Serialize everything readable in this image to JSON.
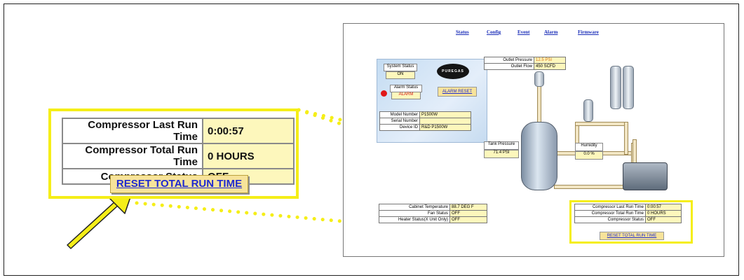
{
  "zoom_panel": {
    "rows": [
      {
        "label": "Compressor Last Run Time",
        "value": "0:00:57"
      },
      {
        "label": "Compressor Total Run Time",
        "value": "0 HOURS"
      },
      {
        "label": "Compressor Status",
        "value": "OFF"
      }
    ],
    "reset_button": "RESET TOTAL RUN TIME"
  },
  "screenshot": {
    "nav": [
      "Status",
      "Config",
      "Event",
      "Alarm",
      "Firmware"
    ],
    "system_status": {
      "label": "System Status",
      "value": "ON"
    },
    "alarm_status": {
      "label": "Alarm Status",
      "value": "ALARM"
    },
    "alarm_reset": "ALARM RESET",
    "logo_text": "PUREGAS",
    "device_info": [
      {
        "label": "Model Number",
        "value": "P1500W"
      },
      {
        "label": "Serial Number",
        "value": ""
      },
      {
        "label": "Device ID",
        "value": "R&D P1500W"
      }
    ],
    "outlet": [
      {
        "label": "Outlet Pressure",
        "value": "12.5 PSI"
      },
      {
        "label": "Outlet Flow",
        "value": "450 SCFD"
      }
    ],
    "tank_pressure": {
      "label": "Tank Pressure",
      "value": "71.4 PSI"
    },
    "humidity": {
      "label": "Humidity",
      "value": "0.0 %"
    },
    "cabinet": [
      {
        "label": "Cabinet Temperature",
        "value": "88.7 DEG F"
      },
      {
        "label": "Fan Status",
        "value": "OFF"
      },
      {
        "label": "Heater Status(X Unit Only)",
        "value": "OFF"
      }
    ],
    "compressor": [
      {
        "label": "Compressor Last Run Time",
        "value": "0:00:57"
      },
      {
        "label": "Compressor Total Run Time",
        "value": "0 HOURS"
      },
      {
        "label": "Compressor Status",
        "value": "OFF"
      }
    ],
    "reset_button": "RESET TOTAL RUN TIME"
  },
  "colors": {
    "highlight": "#f5ee18",
    "value_bg": "#fdf7bc",
    "link": "#1e2ad0",
    "arrow": "#f5ee18"
  }
}
